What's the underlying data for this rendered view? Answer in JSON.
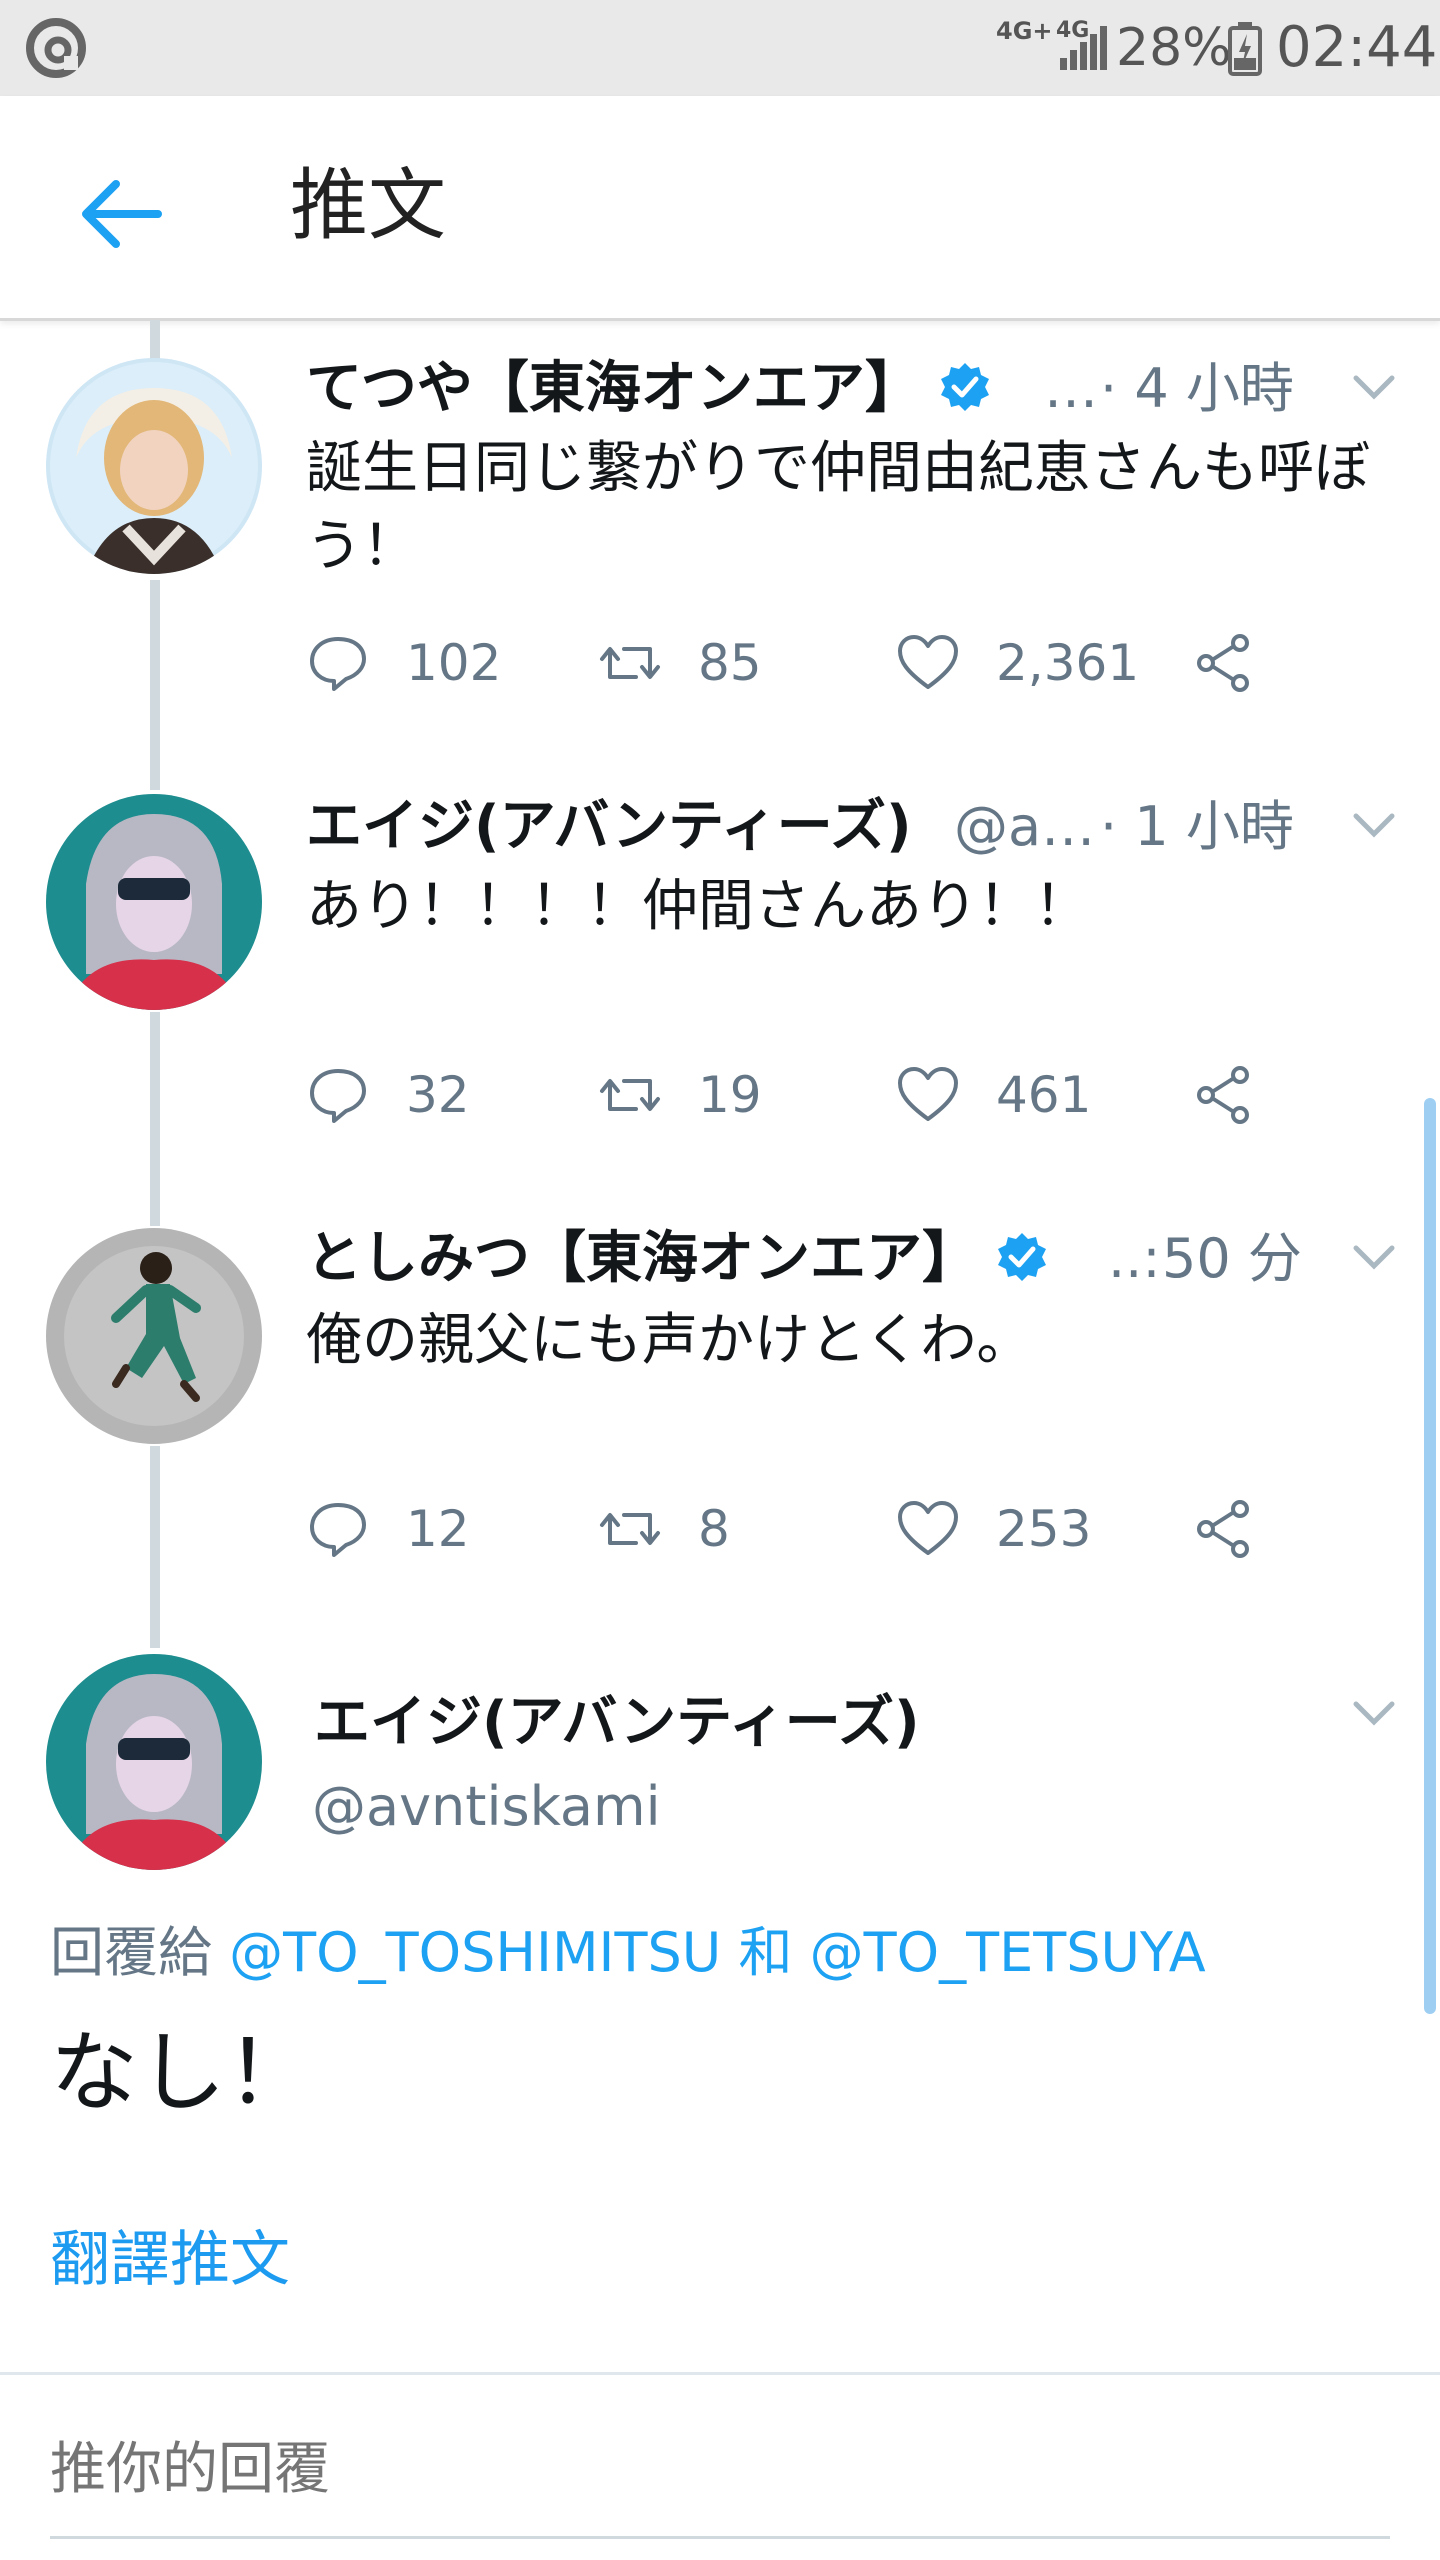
{
  "status_bar": {
    "network_badge": "4G+",
    "network_type": "4G",
    "battery_percent": "28%",
    "time": "02:44",
    "app_icon": "app-notification-icon"
  },
  "header": {
    "back_icon": "arrow-left-icon",
    "title": "推文"
  },
  "thread": [
    {
      "name": "てつや【東海オンエア】",
      "verified": true,
      "handle_truncated": "…",
      "time": "· 4 小時",
      "text": "誕生日同じ繋がりで仲間由紀恵さんも呼ぼう！",
      "replies": "102",
      "retweets": "85",
      "likes": "2,361"
    },
    {
      "name": "エイジ(アバンティーズ)",
      "verified": false,
      "handle_truncated": "@a…",
      "time": "· 1 小時",
      "text": "あり！！！！仲間さんあり！！",
      "replies": "32",
      "retweets": "19",
      "likes": "461"
    },
    {
      "name": "としみつ【東海オンエア】",
      "verified": true,
      "handle_truncated": "..:",
      "time": "50 分",
      "text": "俺の親父にも声かけとくわ。",
      "replies": "12",
      "retweets": "8",
      "likes": "253"
    }
  ],
  "focused": {
    "name": "エイジ(アバンティーズ)",
    "handle": "@avntiskami",
    "reply_prefix": "回覆給",
    "mention_1": "@TO_TOSHIMITSU",
    "reply_joiner": "和",
    "mention_2": "@TO_TETSUYA",
    "text": "なし！",
    "translate_label": "翻譯推文"
  },
  "composer": {
    "placeholder": "推你的回覆"
  },
  "colors": {
    "accent": "#1da1f2",
    "secondary_text": "#657786",
    "thread_line": "#cfd9de"
  }
}
